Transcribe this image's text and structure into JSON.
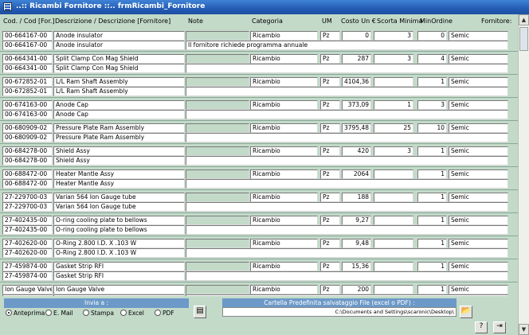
{
  "window": {
    "title": "..:: Ricambi Fornitore ::..   frmRicambi_Fornitore"
  },
  "header": {
    "codice": "Cod. / Cod [For.]",
    "descrizione": "Descrizione / Descrizione [Fornitore]",
    "note": "Note",
    "categoria": "Categoria",
    "um": "UM",
    "costo": "Costo Un €",
    "scorta": "Scorta Minima",
    "minordine": "MinOrdine",
    "fornitore": "Fornitore:"
  },
  "records": [
    {
      "cod": "00-664167-00",
      "cod_for": "00-664167-00",
      "desc": "Anode insulator",
      "desc_for": "Anode insulator",
      "note": "",
      "note2": "Il fornitore richiede programma annuale",
      "categoria": "Ricambio",
      "um": "Pz",
      "costo": "0",
      "scorta": "3",
      "minordine": "0",
      "fornitore": "Semic"
    },
    {
      "cod": "00-664341-00",
      "cod_for": "00-664341-00",
      "desc": "Split Clamp Con Mag Shield",
      "desc_for": "Split Clamp Con Mag Shield",
      "note": "",
      "note2": "",
      "categoria": "Ricambio",
      "um": "Pz",
      "costo": "287",
      "scorta": "3",
      "minordine": "4",
      "fornitore": "Semic"
    },
    {
      "cod": "00-672852-01",
      "cod_for": "00-672852-01",
      "desc": "L/L Ram Shaft Assembly",
      "desc_for": "L/L Ram Shaft Assembly",
      "note": "",
      "note2": "",
      "categoria": "Ricambio",
      "um": "Pz",
      "costo": "4104,36",
      "scorta": "",
      "minordine": "1",
      "fornitore": "Semic"
    },
    {
      "cod": "00-674163-00",
      "cod_for": "00-674163-00",
      "desc": "Anode Cap",
      "desc_for": "Anode Cap",
      "note": "",
      "note2": "",
      "categoria": "Ricambio",
      "um": "Pz",
      "costo": "373,09",
      "scorta": "1",
      "minordine": "3",
      "fornitore": "Semic"
    },
    {
      "cod": "00-680909-02",
      "cod_for": "00-680909-02",
      "desc": "Pressure Plate Ram Assembly",
      "desc_for": "Pressure Plate Ram Assembly",
      "note": "",
      "note2": "",
      "categoria": "Ricambio",
      "um": "Pz",
      "costo": "3795,48",
      "scorta": "25",
      "minordine": "10",
      "fornitore": "Semic"
    },
    {
      "cod": "00-684278-00",
      "cod_for": "00-684278-00",
      "desc": "Shield Assy",
      "desc_for": "Shield Assy",
      "note": "",
      "note2": "",
      "categoria": "Ricambio",
      "um": "Pz",
      "costo": "420",
      "scorta": "3",
      "minordine": "1",
      "fornitore": "Semic"
    },
    {
      "cod": "00-688472-00",
      "cod_for": "00-688472-00",
      "desc": "Heater Mantle Assy",
      "desc_for": "Heater Mantle Assy",
      "note": "",
      "note2": "",
      "categoria": "Ricambio",
      "um": "Pz",
      "costo": "2064",
      "scorta": "",
      "minordine": "1",
      "fornitore": "Semic"
    },
    {
      "cod": "27-229700-03",
      "cod_for": "27-229700-03",
      "desc": "Varian 564 Ion Gauge tube",
      "desc_for": "Varian 564 Ion Gauge tube",
      "note": "",
      "note2": "",
      "categoria": "Ricambio",
      "um": "Pz",
      "costo": "188",
      "scorta": "",
      "minordine": "1",
      "fornitore": "Semic"
    },
    {
      "cod": "27-402435-00",
      "cod_for": "27-402435-00",
      "desc": "O-ring cooling plate to bellows",
      "desc_for": "O-ring cooling plate to bellows",
      "note": "",
      "note2": "",
      "categoria": "Ricambio",
      "um": "Pz",
      "costo": "9,27",
      "scorta": "",
      "minordine": "1",
      "fornitore": "Semic"
    },
    {
      "cod": "27-402620-00",
      "cod_for": "27-402620-00",
      "desc": "O-Ring 2.800 I.D. X .103 W",
      "desc_for": "O-Ring 2.800 I.D. X .103 W",
      "note": "",
      "note2": "",
      "categoria": "Ricambio",
      "um": "Pz",
      "costo": "9,48",
      "scorta": "",
      "minordine": "1",
      "fornitore": "Semic"
    },
    {
      "cod": "27-459874-00",
      "cod_for": "27-459874-00",
      "desc": "Gasket Strip RFI",
      "desc_for": "Gasket Strip RFI",
      "note": "",
      "note2": "",
      "categoria": "Ricambio",
      "um": "Pz",
      "costo": "15,36",
      "scorta": "",
      "minordine": "1",
      "fornitore": "Semic"
    },
    {
      "cod": "Ion Gauge Valve",
      "cod_for": "Ion Gauge Valve",
      "desc": "Ion Gauge Valve",
      "desc_for": "Ion Gauge Valve",
      "note": "",
      "note2": "",
      "categoria": "Ricambio",
      "um": "Pz",
      "costo": "200",
      "scorta": "",
      "minordine": "1",
      "fornitore": "Semic"
    }
  ],
  "footer": {
    "invia_label": "Invia a :",
    "options": [
      "Anteprima",
      "E. Mail",
      "Stampa",
      "Excel",
      "PDF"
    ],
    "selected": "Anteprima",
    "cartella_label": "Cartella Predefinita salvataggio File (excel o PDF) :",
    "cartella_path": "C:\\Documents and Settings\\scaronic\\Desktop\\"
  },
  "icons": {
    "preview": "preview-document-icon",
    "folder": "open-folder-icon",
    "help": "help-key-icon",
    "exit": "exit-door-icon"
  },
  "colors": {
    "background": "#c3dac9",
    "titlebar": "#245cb4",
    "band": "#6c99c8"
  }
}
